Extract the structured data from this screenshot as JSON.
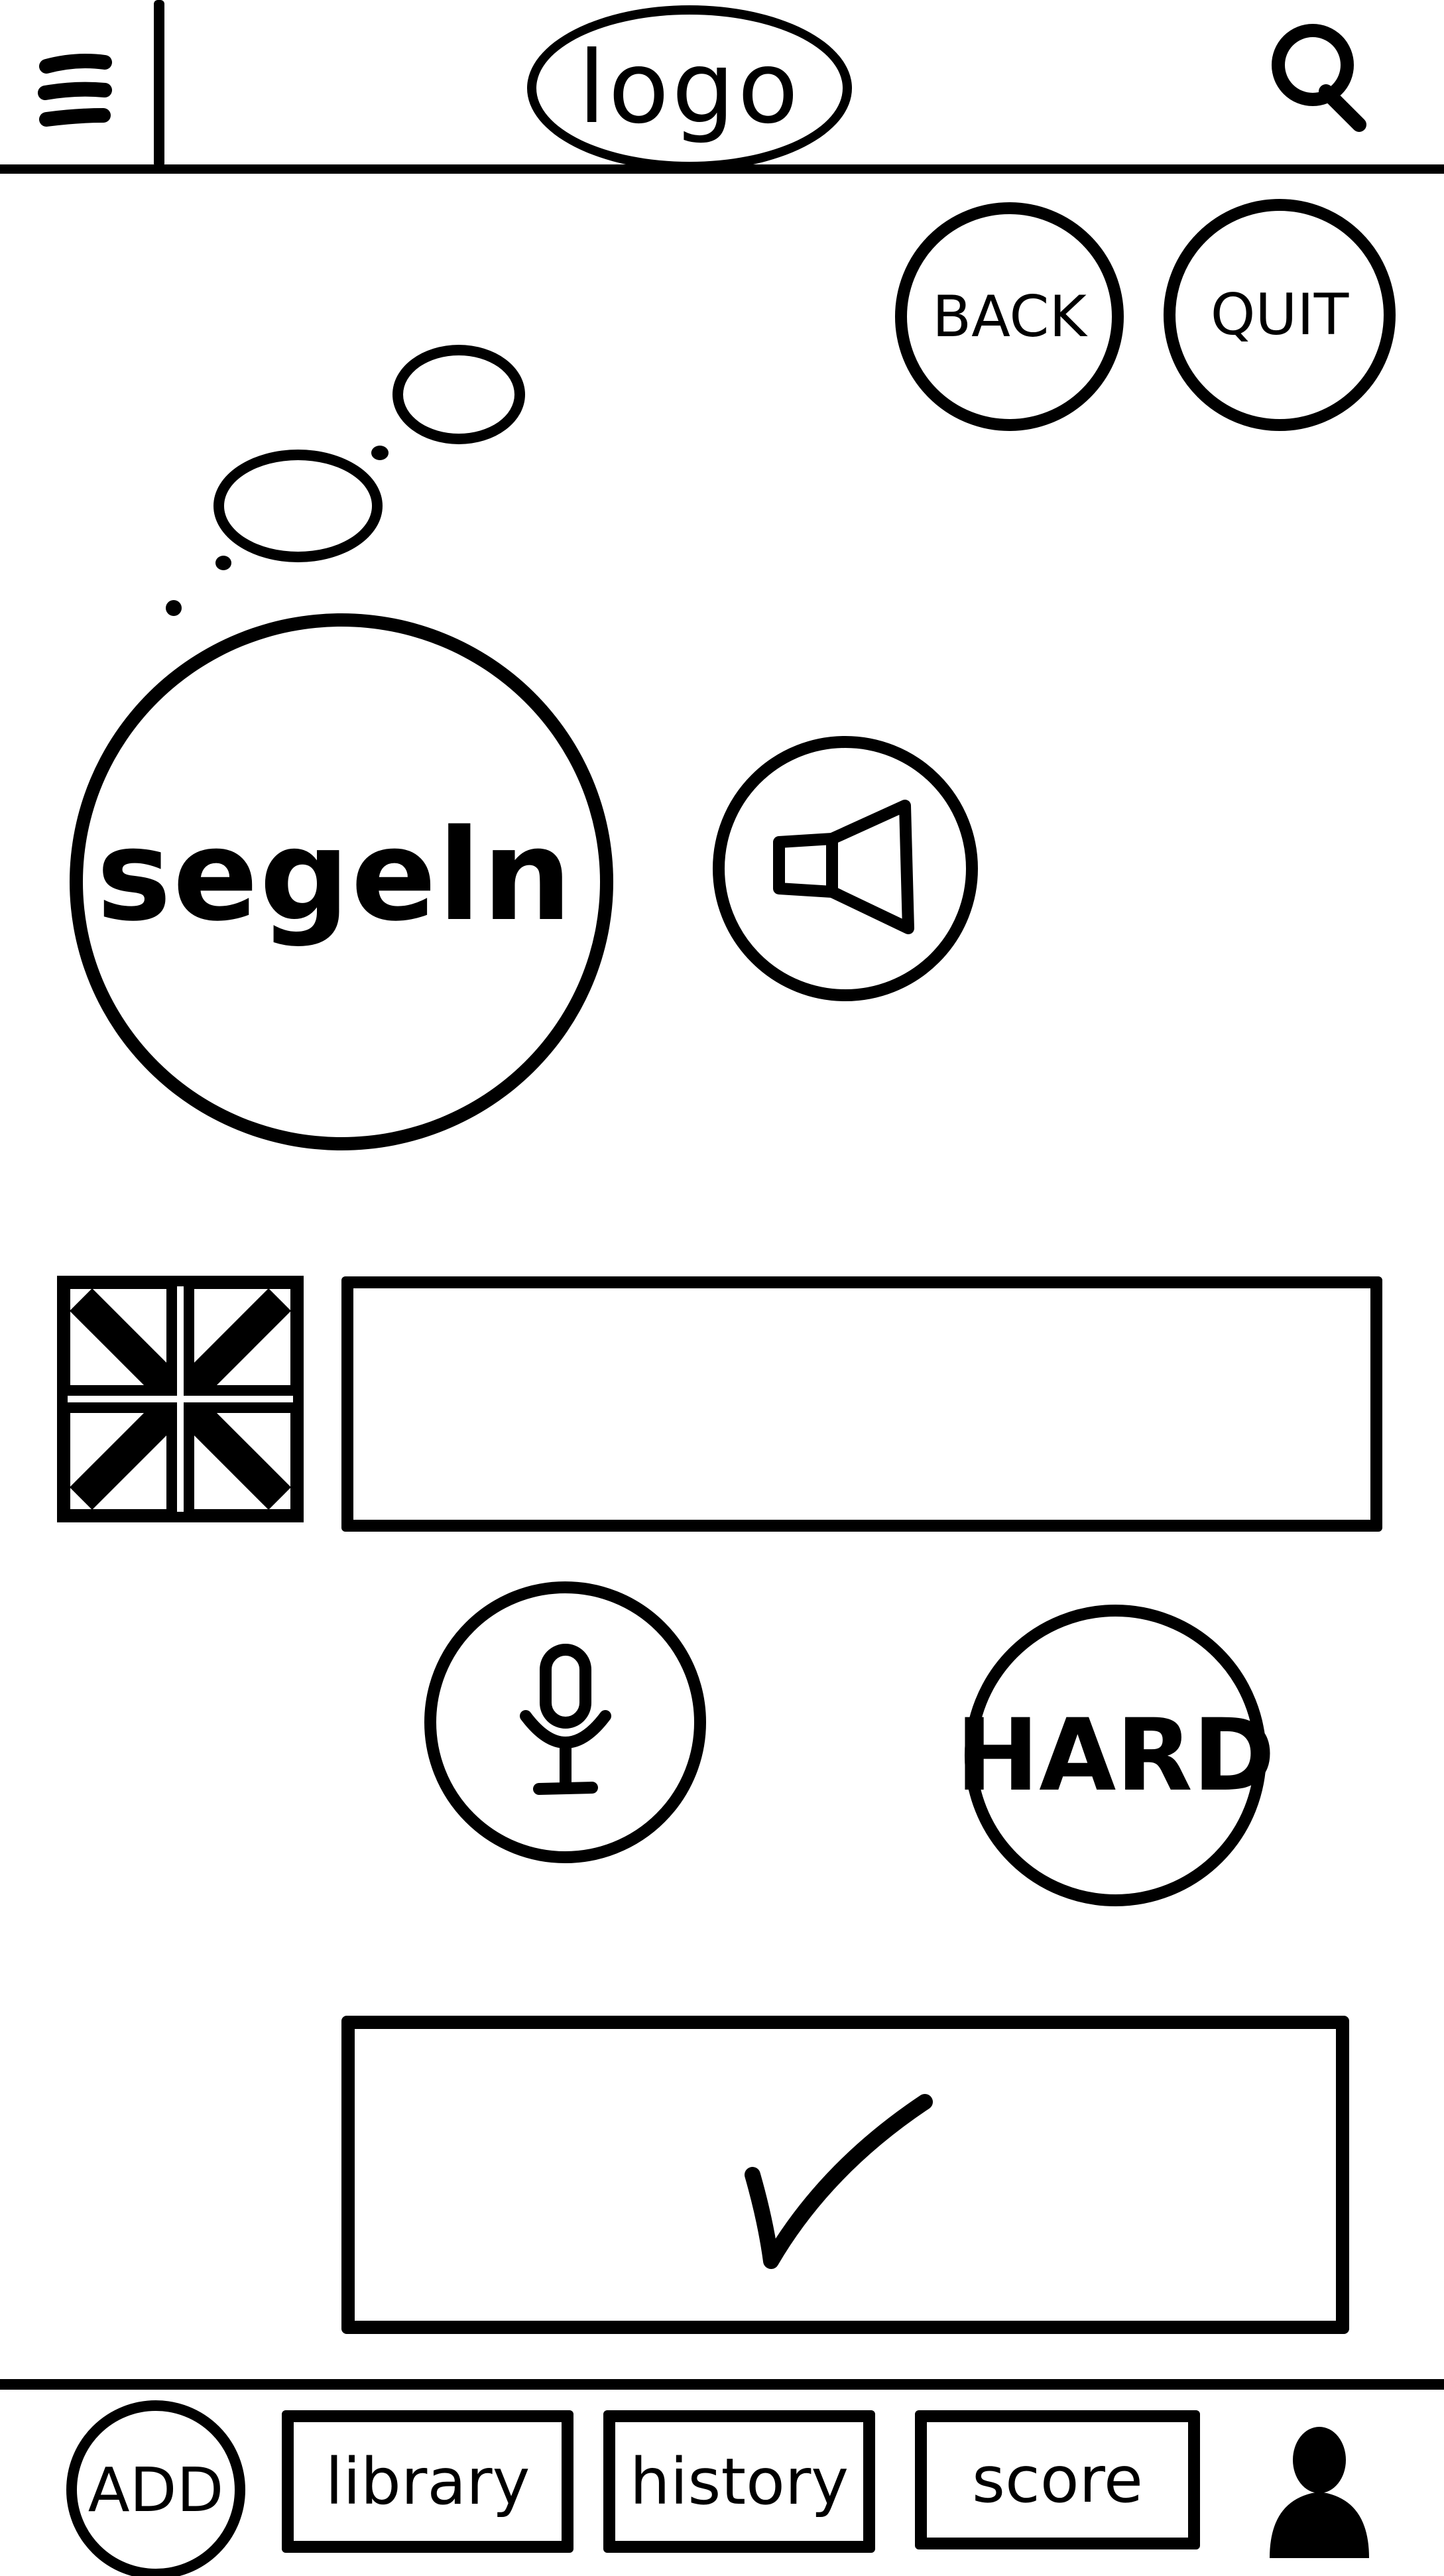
{
  "header": {
    "logo_label": "logo",
    "menu_icon": "hamburger-icon",
    "search_icon": "search-icon"
  },
  "controls": {
    "back_label": "BACK",
    "quit_label": "QUIT"
  },
  "card": {
    "word": "segeln",
    "speaker_icon": "speaker-icon",
    "flag_icon": "uk-flag-icon",
    "answer_value": "",
    "mic_icon": "microphone-icon",
    "difficulty_label": "HARD",
    "confirm_icon": "checkmark-icon"
  },
  "bottom_nav": {
    "add_label": "ADD",
    "tabs": [
      {
        "label": "library"
      },
      {
        "label": "history"
      },
      {
        "label": "score"
      }
    ],
    "profile_icon": "user-icon"
  },
  "colors": {
    "ink": "#000000",
    "paper": "#ffffff"
  }
}
